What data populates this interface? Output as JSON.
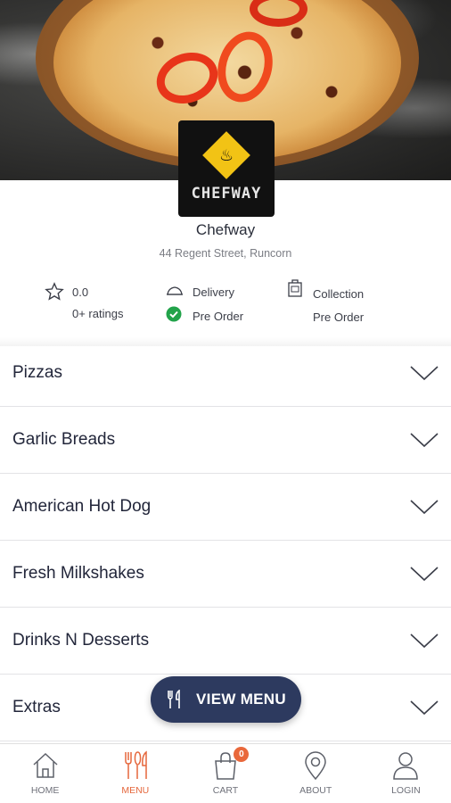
{
  "restaurant": {
    "logo_text": "CHEFWAY",
    "name": "Chefway",
    "address": "44 Regent Street, Runcorn"
  },
  "info": {
    "rating_value": "0.0",
    "rating_count": "0+ ratings",
    "delivery_label": "Delivery",
    "delivery_status": "Pre Order",
    "collection_label": "Collection",
    "collection_status": "Pre Order"
  },
  "categories": [
    {
      "label": "Pizzas"
    },
    {
      "label": "Garlic Breads"
    },
    {
      "label": "American Hot Dog"
    },
    {
      "label": "Fresh Milkshakes"
    },
    {
      "label": "Drinks N Desserts"
    },
    {
      "label": "Extras"
    }
  ],
  "fab": {
    "label": "VIEW MENU",
    "icon": "cutlery-icon"
  },
  "tabbar": {
    "items": [
      {
        "label": "HOME",
        "icon": "home-icon"
      },
      {
        "label": "MENU",
        "icon": "cutlery-icon"
      },
      {
        "label": "CART",
        "icon": "bag-icon",
        "badge": "0"
      },
      {
        "label": "ABOUT",
        "icon": "location-pin-icon"
      },
      {
        "label": "LOGIN",
        "icon": "user-icon"
      }
    ],
    "active_index": 1
  },
  "colors": {
    "primary": "#2d3a5f",
    "accent": "#e5673c",
    "success": "#22a34a",
    "logo_yellow": "#f2c315"
  }
}
